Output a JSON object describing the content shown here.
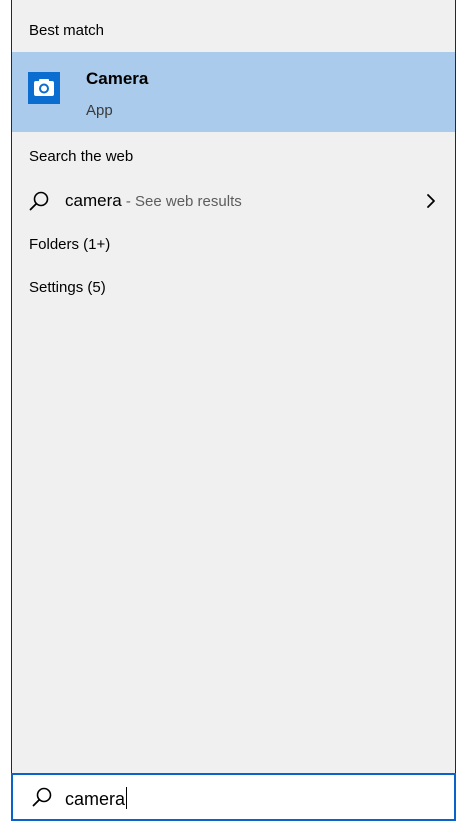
{
  "results": {
    "best_match_header": "Best match",
    "best_match": {
      "icon": "camera-app-icon",
      "title": "Camera",
      "subtitle": "App",
      "accent": "#0c6dd0"
    },
    "web_header": "Search the web",
    "web_result": {
      "term": "camera",
      "suffix": " - See web results"
    },
    "categories": [
      {
        "label": "Folders (1+)"
      },
      {
        "label": "Settings (5)"
      }
    ]
  },
  "search": {
    "value": "camera"
  },
  "colors": {
    "selection": "#aacbeb",
    "panel": "#f0f0f0",
    "focus_border": "#0a63c9"
  }
}
